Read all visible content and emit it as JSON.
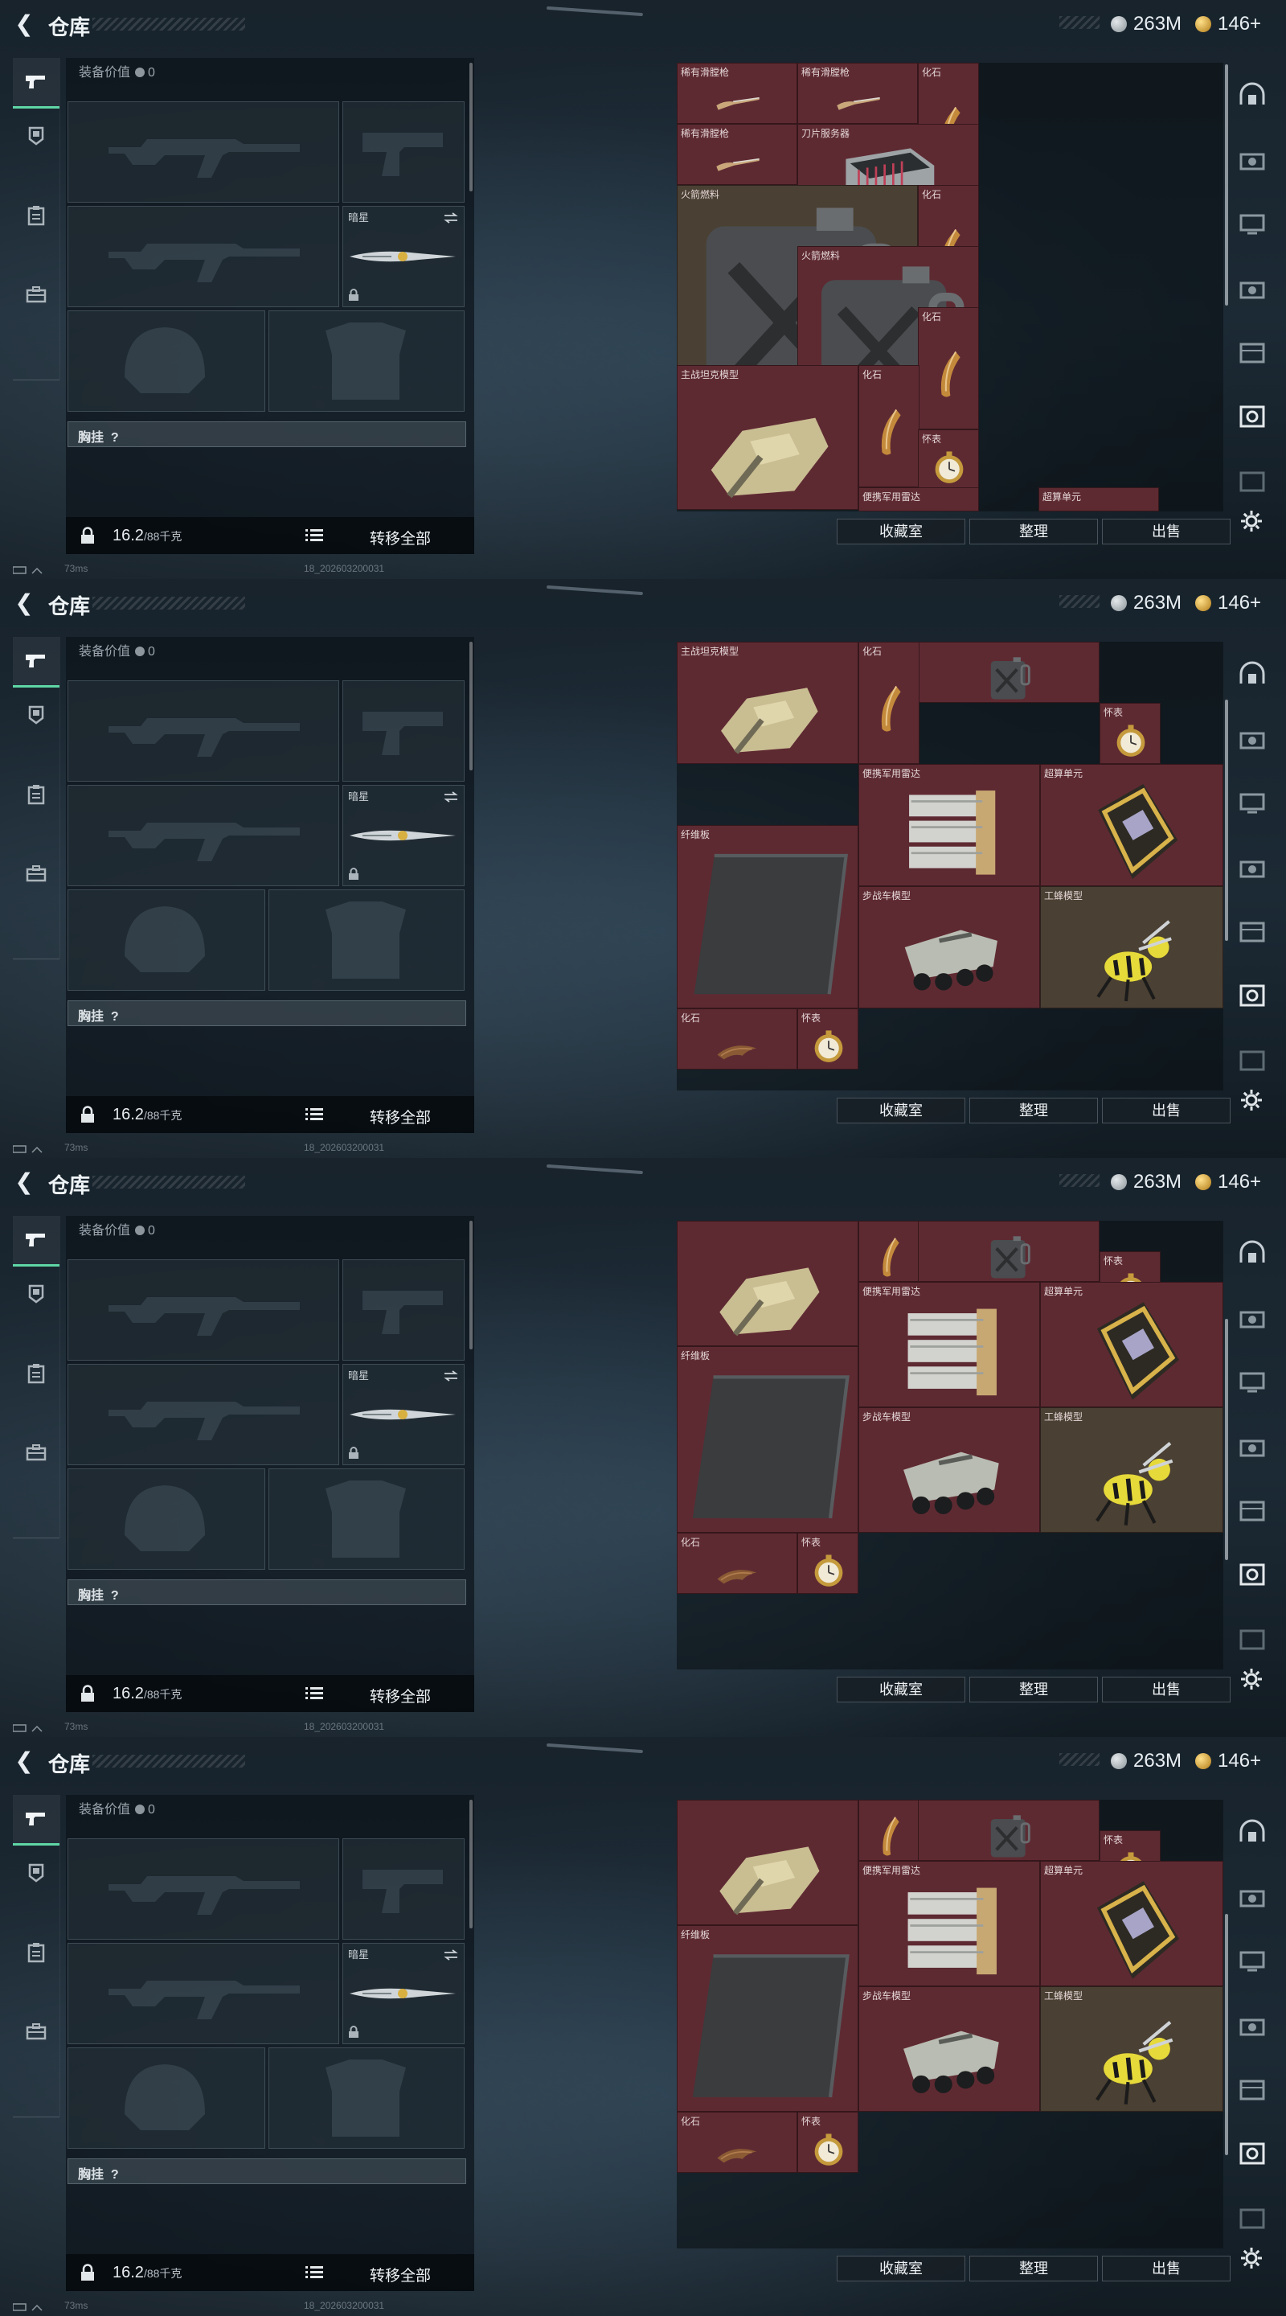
{
  "header": {
    "title": "仓库",
    "silver_currency": "263M",
    "gold_currency": "146+"
  },
  "equipment": {
    "value_label": "装备价值",
    "value": "0",
    "secondary_slot_label": "暗星",
    "vest_label": "胸挂",
    "vest_hint": "?",
    "weight_current": "16.2",
    "weight_capacity": "/88千克",
    "transfer_all_label": "转移全部"
  },
  "actions": {
    "collection_label": "收藏室",
    "sort_label": "整理",
    "sell_label": "出售"
  },
  "status": {
    "ping": "73ms",
    "build_id": "18_202603200031"
  },
  "frames": [
    {
      "items": [
        {
          "label": "稀有滑膛枪",
          "art": "musket"
        },
        {
          "label": "稀有滑膛枪",
          "art": "musket"
        },
        {
          "label": "化石",
          "art": "claw"
        },
        {
          "label": "稀有滑膛枪",
          "art": "musket"
        },
        {
          "label": "刀片服务器",
          "art": "server"
        },
        {
          "label": "火箭燃料",
          "art": "canister"
        },
        {
          "label": "化石",
          "art": "claw"
        },
        {
          "label": "火箭燃料",
          "art": "canister"
        },
        {
          "label": "化石",
          "art": "claw"
        },
        {
          "label": "主战坦克模型",
          "art": "tank"
        },
        {
          "label": "化石",
          "art": "claw"
        },
        {
          "label": "怀表",
          "art": "watch"
        },
        {
          "label": "便携军用雷达",
          "art": "none"
        },
        {
          "label": "超算单元",
          "art": "none"
        }
      ]
    },
    {
      "items": [
        {
          "label": "",
          "art": "canister"
        },
        {
          "label": "主战坦克模型",
          "art": "tank"
        },
        {
          "label": "化石",
          "art": "claw"
        },
        {
          "label": "怀表",
          "art": "watch"
        },
        {
          "label": "便携军用雷达",
          "art": "radar"
        },
        {
          "label": "超算单元",
          "art": "board"
        },
        {
          "label": "纤维板",
          "art": "panel"
        },
        {
          "label": "步战车模型",
          "art": "apc"
        },
        {
          "label": "工蜂模型",
          "art": "wasp"
        },
        {
          "label": "化石",
          "art": "fossil"
        },
        {
          "label": "怀表",
          "art": "watch"
        }
      ]
    },
    {
      "items": [
        {
          "label": "",
          "art": "tank"
        },
        {
          "label": "",
          "art": "claw"
        },
        {
          "label": "",
          "art": "canister"
        },
        {
          "label": "怀表",
          "art": "watch"
        },
        {
          "label": "便携军用雷达",
          "art": "radar"
        },
        {
          "label": "超算单元",
          "art": "board"
        },
        {
          "label": "纤维板",
          "art": "panel"
        },
        {
          "label": "步战车模型",
          "art": "apc"
        },
        {
          "label": "工蜂模型",
          "art": "wasp"
        },
        {
          "label": "化石",
          "art": "fossil"
        },
        {
          "label": "怀表",
          "art": "watch"
        }
      ]
    },
    {
      "items": [
        {
          "label": "",
          "art": "tank"
        },
        {
          "label": "",
          "art": "claw"
        },
        {
          "label": "",
          "art": "canister"
        },
        {
          "label": "怀表",
          "art": "watch"
        },
        {
          "label": "便携军用雷达",
          "art": "radar"
        },
        {
          "label": "超算单元",
          "art": "board"
        },
        {
          "label": "纤维板",
          "art": "panel"
        },
        {
          "label": "步战车模型",
          "art": "apc"
        },
        {
          "label": "工蜂模型",
          "art": "wasp"
        },
        {
          "label": "化石",
          "art": "fossil"
        },
        {
          "label": "怀表",
          "art": "watch"
        }
      ]
    }
  ],
  "colors": {
    "cell_red": "#5e2a32",
    "cell_gold": "#4a4033",
    "accent_green": "#5fd6a6",
    "background": "#18232c"
  }
}
